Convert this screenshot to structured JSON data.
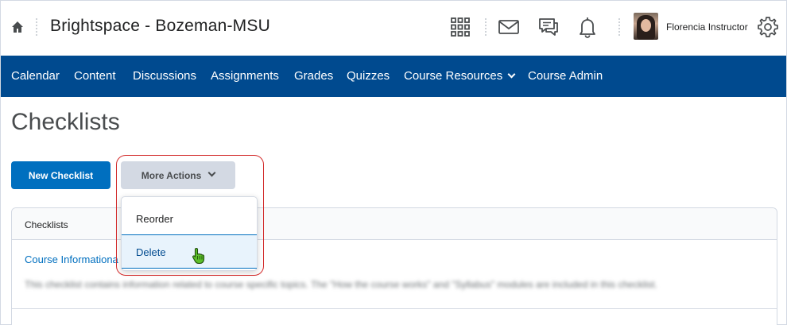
{
  "header": {
    "org_title": "Brightspace - Bozeman-MSU",
    "user_name": "Florencia Instructor",
    "icons": [
      "home-icon",
      "waffle-icon",
      "mail-icon",
      "chat-icon",
      "bell-icon",
      "gear-icon"
    ]
  },
  "nav": {
    "items": [
      "Calendar",
      "Content",
      "Discussions",
      "Assignments",
      "Grades",
      "Quizzes",
      "Course Resources",
      "Course Admin"
    ]
  },
  "page": {
    "title": "Checklists"
  },
  "actions": {
    "new_label": "New Checklist",
    "more_label": "More Actions"
  },
  "dropdown": {
    "items": [
      "Reorder",
      "Delete"
    ]
  },
  "table": {
    "header": "Checklists",
    "rows": [
      {
        "title": "Course Informationa",
        "description": "This checklist contains information related to course specific topics. The \"How the course works\" and \"Syllabus\" modules are included in this checklist."
      }
    ]
  },
  "colors": {
    "nav_bg": "#004a8f",
    "primary_button": "#006fbf",
    "secondary_button": "#d3d9e3",
    "highlight_outline": "#d22a2a",
    "link": "#006fbf"
  }
}
